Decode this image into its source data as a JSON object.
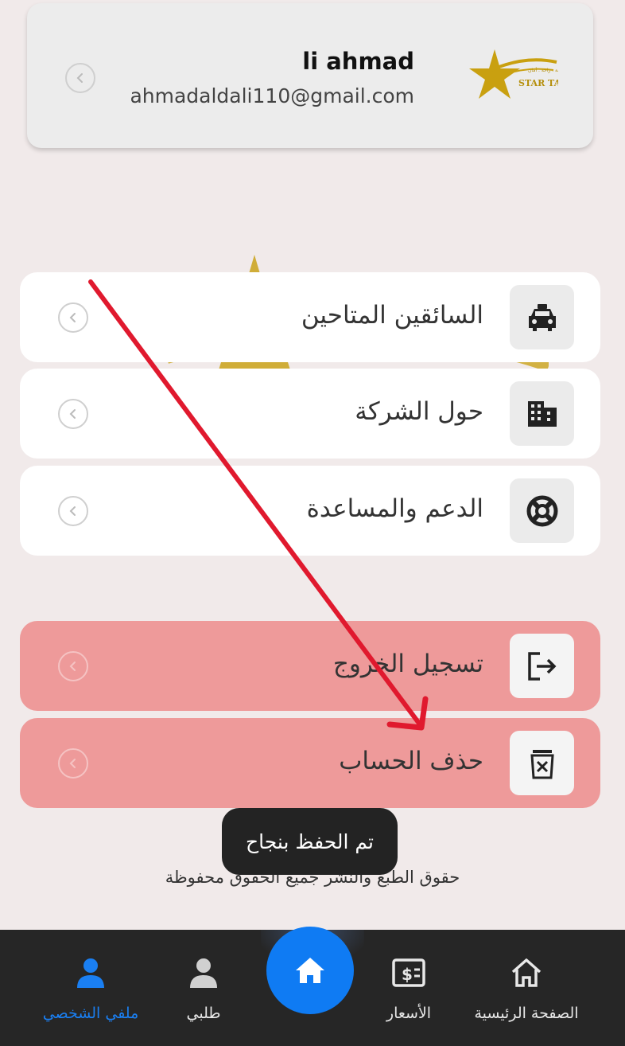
{
  "profile": {
    "name": "li ahmad",
    "email": "ahmadaldali110@gmail.com",
    "logo_text": "STAR TAXI",
    "logo_tagline": "سرعة . راحة . أمان"
  },
  "menu": {
    "items": [
      {
        "label": "السائقين المتاحين",
        "icon": "taxi-icon"
      },
      {
        "label": "حول الشركة",
        "icon": "building-icon"
      },
      {
        "label": "الدعم والمساعدة",
        "icon": "lifebuoy-icon"
      },
      {
        "label": "تسجيل الخروج",
        "icon": "logout-icon"
      },
      {
        "label": "حذف الحساب",
        "icon": "delete-icon"
      }
    ]
  },
  "toast": {
    "text": "تم الحفظ بنجاح"
  },
  "footer": {
    "copyright": "حقوق الطبع والنشر جميع الحقوق محفوظة"
  },
  "nav": {
    "items": [
      {
        "label": "الصفحة الرئيسية",
        "icon": "home-outline-icon"
      },
      {
        "label": "الأسعار",
        "icon": "price-icon"
      },
      {
        "label": "طلبي",
        "icon": "person-icon"
      },
      {
        "label": "ملفي الشخصي",
        "icon": "person-icon"
      }
    ],
    "active_index": 3,
    "fab_icon": "home-icon"
  },
  "colors": {
    "background": "#f1eaea",
    "danger": "#ee9a9a",
    "accent": "#1a7ff2",
    "nav_bg": "#262626",
    "annotation_arrow": "#e0192e",
    "logo_gold": "#c9a010"
  }
}
